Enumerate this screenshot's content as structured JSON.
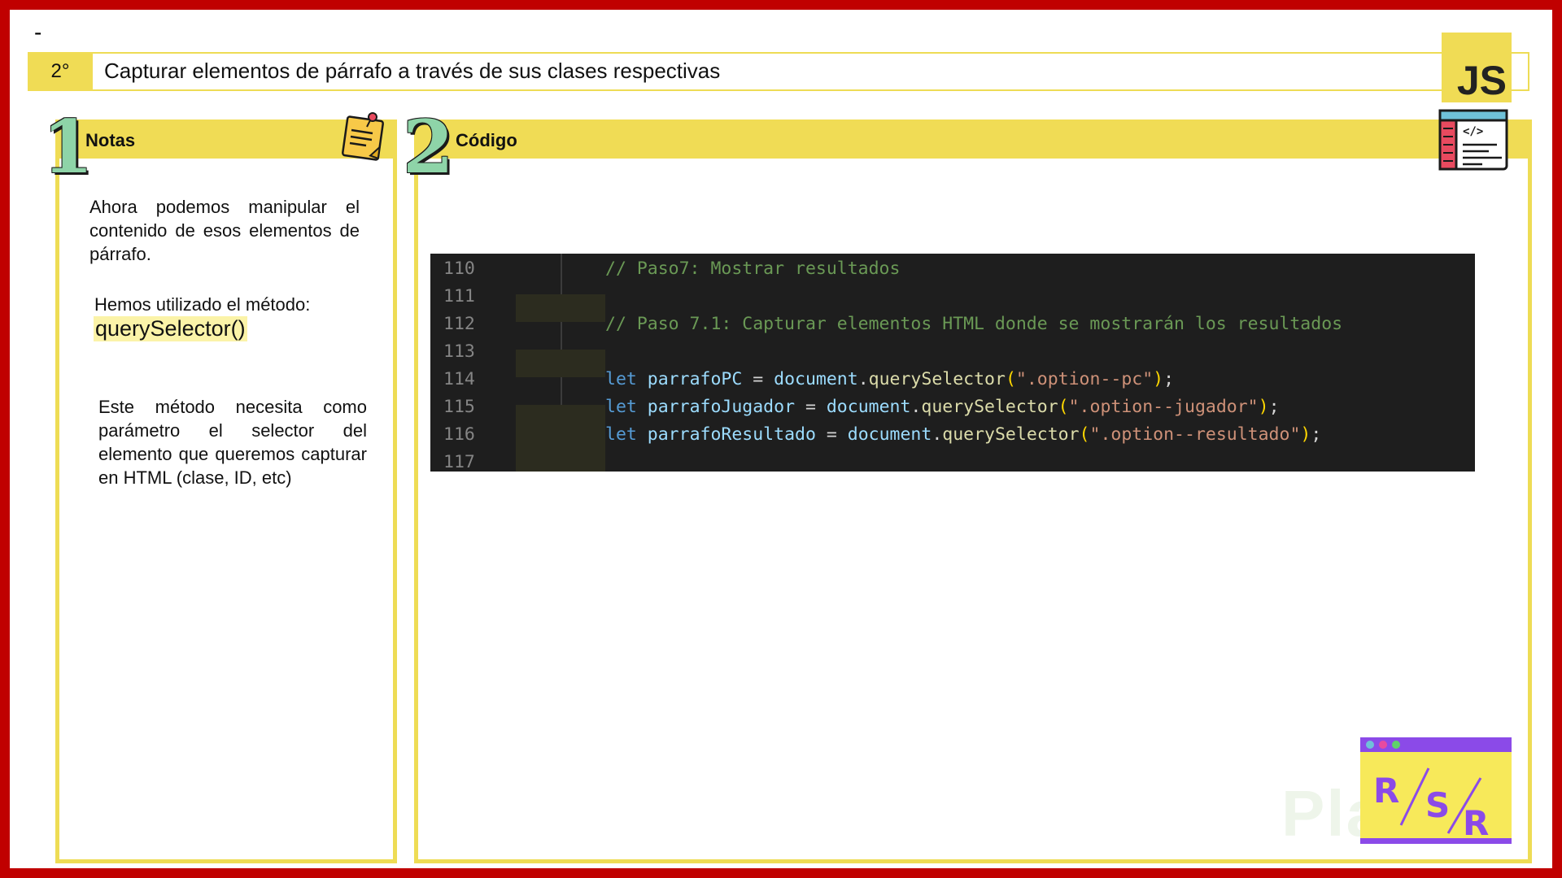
{
  "header": {
    "dash": "-",
    "step": "2°",
    "title": "Capturar elementos de párrafo a través de sus clases respectivas",
    "logo_text": "JS"
  },
  "notes": {
    "number": "1",
    "title": "Notas",
    "icon": "sticky-note-icon",
    "paragraph1": "Ahora podemos manipular el contenido de esos elementos de párrafo.",
    "paragraph2": "Hemos utilizado el método:",
    "method": "querySelector()",
    "paragraph3": "Este método necesita como parámetro el selector del elemento que queremos capturar en HTML (clase, ID, etc)"
  },
  "code_panel": {
    "number": "2",
    "title": "Código",
    "icon": "code-window-icon",
    "lines": [
      {
        "num": "110",
        "comment": "// Paso7: Mostrar resultados"
      },
      {
        "num": "111"
      },
      {
        "num": "112",
        "comment": "// Paso 7.1: Capturar elementos HTML donde se mostrarán los resultados"
      },
      {
        "num": "113"
      },
      {
        "num": "114",
        "kw": "let",
        "var": "parrafoPC",
        "eq": " = ",
        "obj": "document",
        "dot": ".",
        "fn": "querySelector",
        "open": "(",
        "str": "\".option--pc\"",
        "close": ")",
        "semi": ";"
      },
      {
        "num": "115",
        "kw": "let",
        "var": "parrafoJugador",
        "eq": " = ",
        "obj": "document",
        "dot": ".",
        "fn": "querySelector",
        "open": "(",
        "str": "\".option--jugador\"",
        "close": ")",
        "semi": ";"
      },
      {
        "num": "116",
        "kw": "let",
        "var": "parrafoResultado",
        "eq": " = ",
        "obj": "document",
        "dot": ".",
        "fn": "querySelector",
        "open": "(",
        "str": "\".option--resultado\"",
        "close": ")",
        "semi": ";"
      },
      {
        "num": "117"
      }
    ]
  },
  "brand": {
    "badge_icon": "rsr-badge-icon",
    "badge_letters": [
      "R",
      "S",
      "R"
    ],
    "watermark": "Platzi"
  },
  "colors": {
    "frame": "#c00000",
    "accent_yellow": "#f0dc55",
    "number_green": "#8ed4a8",
    "editor_bg": "#1e1e1e"
  }
}
